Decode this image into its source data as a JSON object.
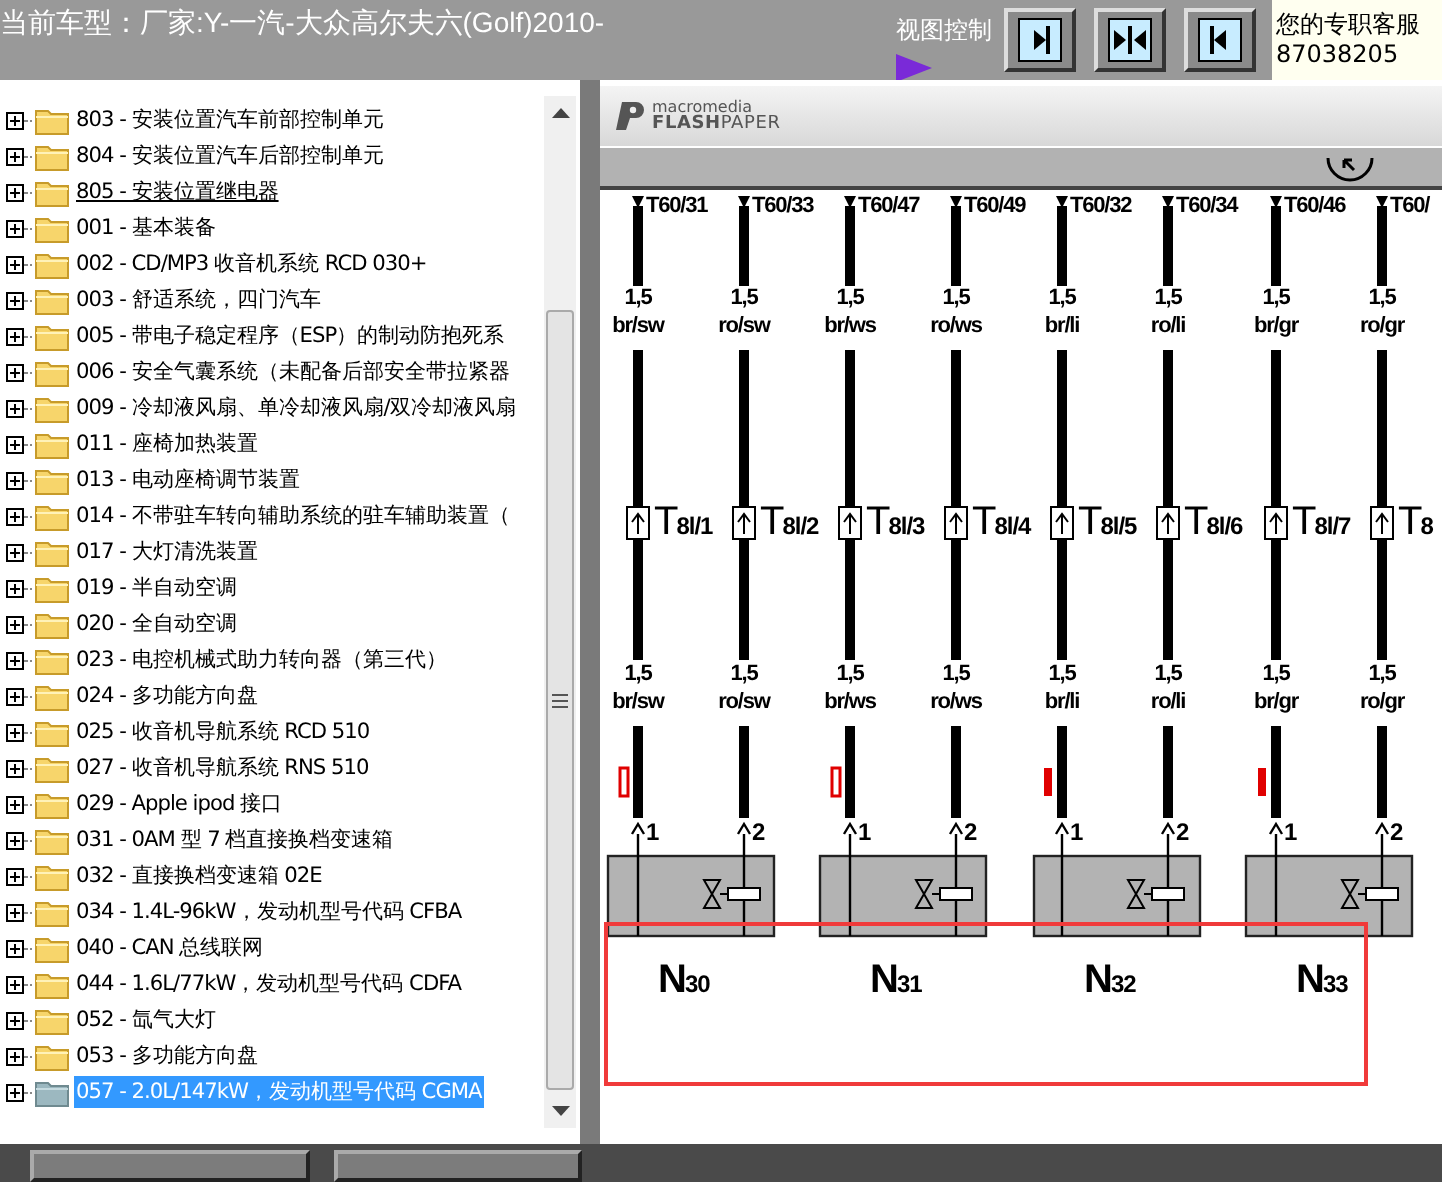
{
  "header": {
    "car_model": "当前车型：厂家:Y-一汽-大众高尔夫六(Golf)2010-",
    "view_control_label": "视图控制",
    "view_buttons": [
      {
        "kind": "right"
      },
      {
        "kind": "both"
      },
      {
        "kind": "left"
      }
    ],
    "service": {
      "title": "您的专职客服",
      "phone": "87038205"
    }
  },
  "tree": {
    "items": [
      {
        "label": "803 - 安装位置汽车前部控制单元",
        "expanded": false,
        "selected": false,
        "hovered": false
      },
      {
        "label": "804 - 安装位置汽车后部控制单元",
        "expanded": false,
        "selected": false,
        "hovered": false
      },
      {
        "label": "805 - 安装位置继电器",
        "expanded": false,
        "selected": false,
        "hovered": true
      },
      {
        "label": "001 - 基本装备",
        "expanded": false,
        "selected": false,
        "hovered": false
      },
      {
        "label": "002 - CD/MP3 收音机系统 RCD 030+",
        "expanded": false,
        "selected": false,
        "hovered": false
      },
      {
        "label": "003 - 舒适系统，四门汽车",
        "expanded": false,
        "selected": false,
        "hovered": false
      },
      {
        "label": "005 - 带电子稳定程序（ESP）的制动防抱死系",
        "expanded": false,
        "selected": false,
        "hovered": false
      },
      {
        "label": "006 - 安全气囊系统（未配备后部安全带拉紧器",
        "expanded": false,
        "selected": false,
        "hovered": false
      },
      {
        "label": "009 - 冷却液风扇、单冷却液风扇/双冷却液风扇",
        "expanded": false,
        "selected": false,
        "hovered": false
      },
      {
        "label": "011 - 座椅加热装置",
        "expanded": false,
        "selected": false,
        "hovered": false
      },
      {
        "label": "013 - 电动座椅调节装置",
        "expanded": false,
        "selected": false,
        "hovered": false
      },
      {
        "label": "014 - 不带驻车转向辅助系统的驻车辅助装置（",
        "expanded": false,
        "selected": false,
        "hovered": false
      },
      {
        "label": "017 - 大灯清洗装置",
        "expanded": false,
        "selected": false,
        "hovered": false
      },
      {
        "label": "019 - 半自动空调",
        "expanded": false,
        "selected": false,
        "hovered": false
      },
      {
        "label": "020 - 全自动空调",
        "expanded": false,
        "selected": false,
        "hovered": false
      },
      {
        "label": "023 - 电控机械式助力转向器（第三代）",
        "expanded": false,
        "selected": false,
        "hovered": false
      },
      {
        "label": "024 - 多功能方向盘",
        "expanded": false,
        "selected": false,
        "hovered": false
      },
      {
        "label": "025 - 收音机导航系统 RCD 510",
        "expanded": false,
        "selected": false,
        "hovered": false
      },
      {
        "label": "027 - 收音机导航系统 RNS 510",
        "expanded": false,
        "selected": false,
        "hovered": false
      },
      {
        "label": "029 - Apple ipod 接口",
        "expanded": false,
        "selected": false,
        "hovered": false
      },
      {
        "label": "031 - 0AM 型 7 档直接换档变速箱",
        "expanded": false,
        "selected": false,
        "hovered": false
      },
      {
        "label": "032 - 直接换档变速箱 02E",
        "expanded": false,
        "selected": false,
        "hovered": false
      },
      {
        "label": "034 - 1.4L-96kW，发动机型号代码 CFBA",
        "expanded": false,
        "selected": false,
        "hovered": false
      },
      {
        "label": "040 - CAN 总线联网",
        "expanded": false,
        "selected": false,
        "hovered": false
      },
      {
        "label": "044 - 1.6L/77kW，发动机型号代码 CDFA",
        "expanded": false,
        "selected": false,
        "hovered": false
      },
      {
        "label": "052 - 氙气大灯",
        "expanded": false,
        "selected": false,
        "hovered": false
      },
      {
        "label": "053 - 多功能方向盘",
        "expanded": false,
        "selected": false,
        "hovered": false
      },
      {
        "label": "057 - 2.0L/147kW，发动机型号代码 CGMA",
        "expanded": false,
        "selected": true,
        "hovered": false
      }
    ]
  },
  "viewer": {
    "brand": "macromedia",
    "product": "**FLASH**PAPER"
  },
  "diagram": {
    "wires": [
      {
        "terminal": "T60/31",
        "gauge": "1,5",
        "color_code": "br/sw",
        "connector": "T$_{8l/1}$",
        "gauge_lower": "1,5",
        "color_code_lower": "br/sw",
        "kind": "outline",
        "pin": "1"
      },
      {
        "terminal": "T60/33",
        "gauge": "1,5",
        "color_code": "ro/sw",
        "connector": "T$_{8l/2}$",
        "gauge_lower": "1,5",
        "color_code_lower": "ro/sw",
        "kind": "plain",
        "pin": "2"
      },
      {
        "terminal": "T60/47",
        "gauge": "1,5",
        "color_code": "br/ws",
        "connector": "T$_{8l/3}$",
        "gauge_lower": "1,5",
        "color_code_lower": "br/ws",
        "kind": "outline",
        "pin": "1"
      },
      {
        "terminal": "T60/49",
        "gauge": "1,5",
        "color_code": "ro/ws",
        "connector": "T$_{8l/4}$",
        "gauge_lower": "1,5",
        "color_code_lower": "ro/ws",
        "kind": "plain",
        "pin": "2"
      },
      {
        "terminal": "T60/32",
        "gauge": "1,5",
        "color_code": "br/li",
        "connector": "T$_{8l/5}$",
        "gauge_lower": "1,5",
        "color_code_lower": "br/li",
        "kind": "filled",
        "pin": "1"
      },
      {
        "terminal": "T60/34",
        "gauge": "1,5",
        "color_code": "ro/li",
        "connector": "T$_{8l/6}$",
        "gauge_lower": "1,5",
        "color_code_lower": "ro/li",
        "kind": "plain",
        "pin": "2"
      },
      {
        "terminal": "T60/46",
        "gauge": "1,5",
        "color_code": "br/gr",
        "connector": "T$_{8l/7}$",
        "gauge_lower": "1,5",
        "color_code_lower": "br/gr",
        "kind": "filled",
        "pin": "1"
      },
      {
        "terminal": "T60/",
        "gauge": "1,5",
        "color_code": "ro/gr",
        "connector": "T$_{8}$",
        "gauge_lower": "1,5",
        "color_code_lower": "ro/gr",
        "kind": "plain",
        "pin": "2"
      }
    ],
    "components": [
      {
        "label": "N$_{30}$"
      },
      {
        "label": "N$_{31}$"
      },
      {
        "label": "N$_{32}$"
      },
      {
        "label": "N$_{33}$"
      }
    ]
  }
}
